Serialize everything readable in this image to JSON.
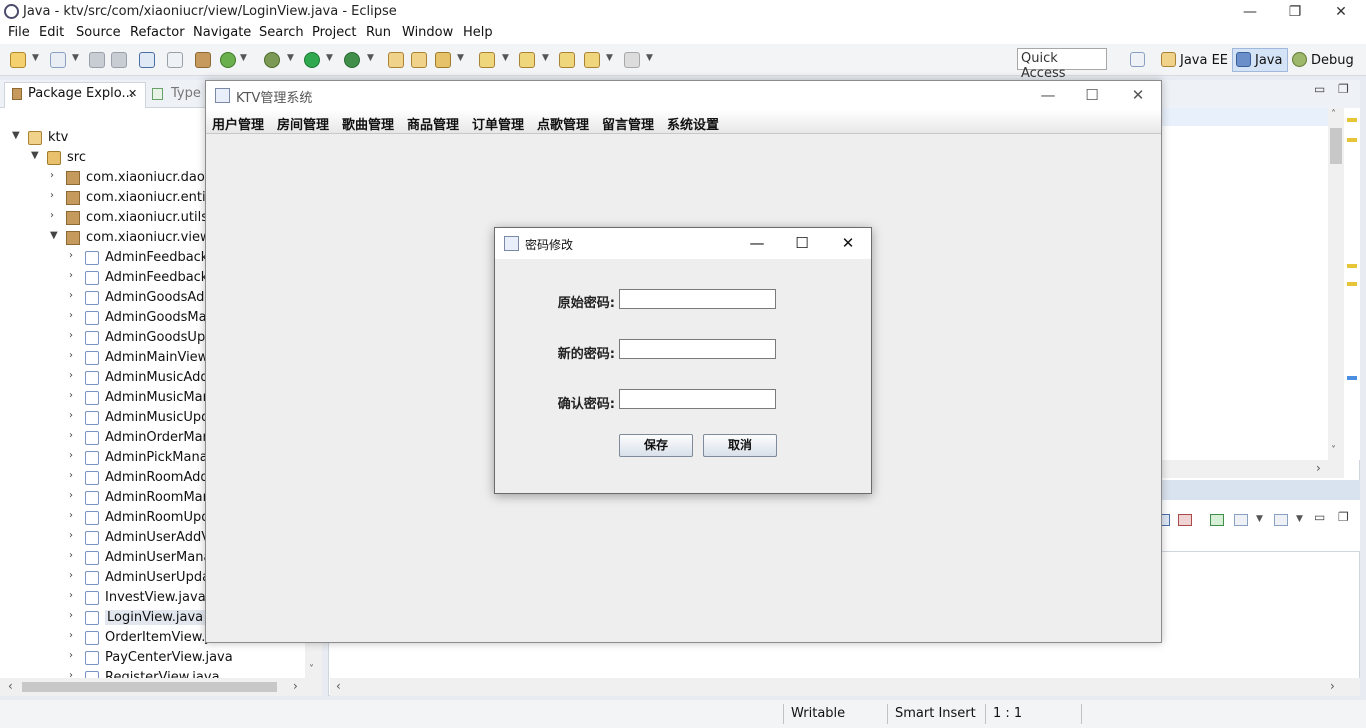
{
  "eclipse": {
    "window_title": "Java - ktv/src/com/xiaoniucr/view/LoginView.java - Eclipse",
    "window_controls": {
      "minimize": "—",
      "restore": "❐",
      "close": "✕"
    },
    "menu": [
      "File",
      "Edit",
      "Source",
      "Refactor",
      "Navigate",
      "Search",
      "Project",
      "Run",
      "Window",
      "Help"
    ],
    "quick_access": "Quick Access",
    "perspectives": [
      "Java EE",
      "Java",
      "Debug"
    ],
    "explorer_tabs": {
      "package_explorer": "Package Explo...",
      "package_explorer_close": "✕",
      "type_hierarchy": "Type"
    },
    "tree": {
      "project": "ktv",
      "src": "src",
      "packages": [
        "com.xiaoniucr.dao",
        "com.xiaoniucr.entity",
        "com.xiaoniucr.utils",
        "com.xiaoniucr.view"
      ],
      "files": [
        "AdminFeedbackM",
        "AdminFeedbackR",
        "AdminGoodsAdd",
        "AdminGoodsMar",
        "AdminGoodsUpd",
        "AdminMainView.j",
        "AdminMusicAddV",
        "AdminMusicMana",
        "AdminMusicUpda",
        "AdminOrderMana",
        "AdminPickManag",
        "AdminRoomAddV",
        "AdminRoomMana",
        "AdminRoomUpda",
        "AdminUserAddVi",
        "AdminUserManag",
        "AdminUserUpdat",
        "InvestView.java",
        "LoginView.java",
        "OrderItemView.java",
        "PayCenterView.java",
        "RegisterView.java"
      ],
      "selected_file": "LoginView.java"
    },
    "status": {
      "writable": "Writable",
      "insert_mode": "Smart Insert",
      "position": "1 : 1"
    },
    "colors": {
      "ruler_warning": "#e8c437",
      "ruler_info": "#4a8fe0"
    }
  },
  "ktv": {
    "title": "KTV管理系统",
    "window_controls": {
      "minimize": "—",
      "maximize": "☐",
      "close": "✕"
    },
    "menu": [
      "用户管理",
      "房间管理",
      "歌曲管理",
      "商品管理",
      "订单管理",
      "点歌管理",
      "留言管理",
      "系统设置"
    ]
  },
  "dialog": {
    "title": "密码修改",
    "window_controls": {
      "minimize": "—",
      "maximize": "☐",
      "close": "✕"
    },
    "fields": [
      {
        "label": "原始密码:",
        "value": ""
      },
      {
        "label": "新的密码:",
        "value": ""
      },
      {
        "label": "确认密码:",
        "value": ""
      }
    ],
    "save_label": "保存",
    "cancel_label": "取消"
  }
}
